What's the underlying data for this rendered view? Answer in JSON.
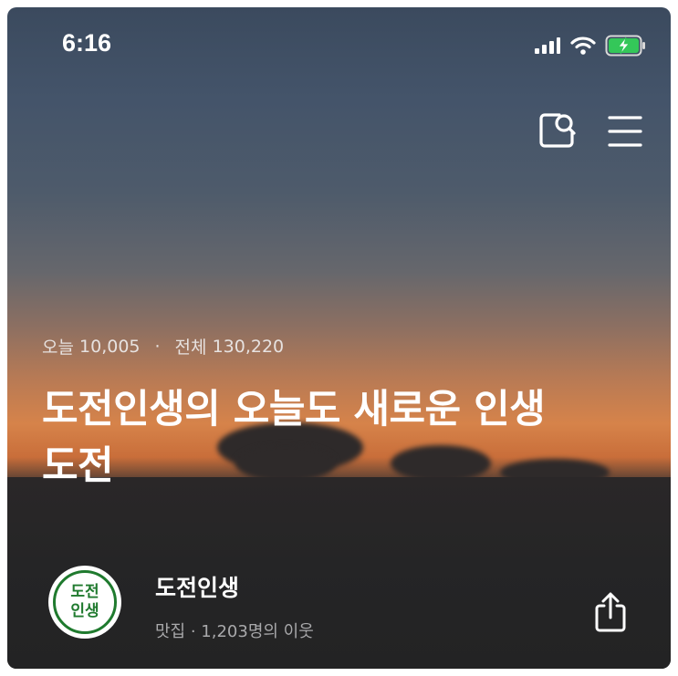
{
  "status_bar": {
    "time": "6:16",
    "icons": [
      "signal-icon",
      "wifi-icon",
      "battery-charging-icon"
    ]
  },
  "header": {
    "icons": [
      "search-icon",
      "menu-icon"
    ]
  },
  "stats": {
    "today_label": "오늘",
    "today_value": "10,005",
    "separator": "·",
    "total_label": "전체",
    "total_value": "130,220"
  },
  "title_line1": "도전인생의 오늘도 새로운 인생",
  "title_line2": "도전",
  "blog": {
    "avatar_line1": "도전",
    "avatar_line2": "인생",
    "name": "도전인생",
    "meta": "맛집 · 1,203명의 이웃"
  },
  "colors": {
    "avatar_accent": "#1f7a2e",
    "battery_fill": "#34c759"
  }
}
